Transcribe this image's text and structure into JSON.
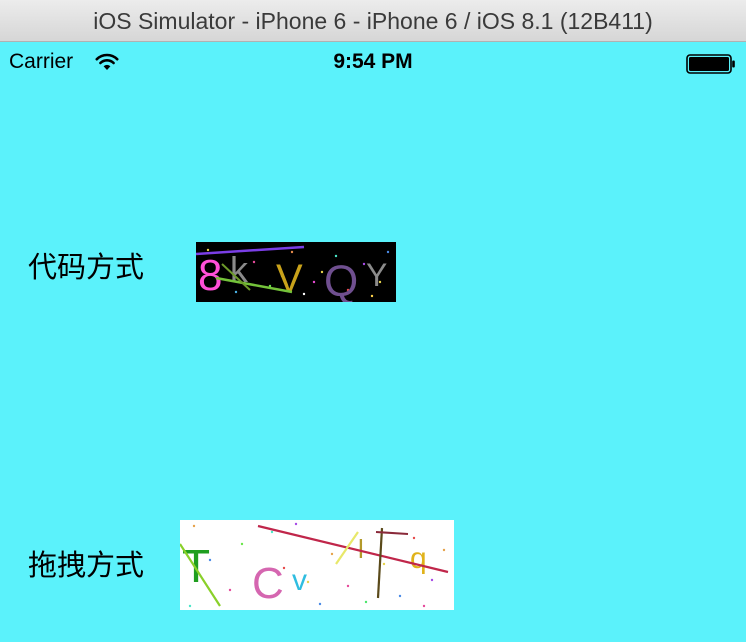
{
  "window": {
    "title": "iOS Simulator - iPhone 6 - iPhone 6 / iOS 8.1 (12B411)"
  },
  "status_bar": {
    "carrier": "Carrier",
    "time": "9:54 PM",
    "wifi_icon": "wifi-icon",
    "battery_icon": "battery-full-icon"
  },
  "screen": {
    "background_color": "#5bf2fb"
  },
  "rows": {
    "code": {
      "label": "代码方式",
      "captcha": {
        "background_color": "#000000",
        "chars": [
          "8",
          "k",
          "V",
          "Q",
          "Y"
        ],
        "char_colors": [
          "#ff4fd8",
          "#8a8a8a",
          "#c9a21a",
          "#6f4f8f",
          "#8b8b8b"
        ]
      }
    },
    "drag": {
      "label": "拖拽方式",
      "captcha": {
        "background_color": "#ffffff",
        "chars": [
          "T",
          "C",
          "v",
          "l",
          "q"
        ],
        "char_colors": [
          "#1f9e1f",
          "#d566b0",
          "#2fbde0",
          "#b39a2a",
          "#e0b21a"
        ]
      }
    }
  }
}
